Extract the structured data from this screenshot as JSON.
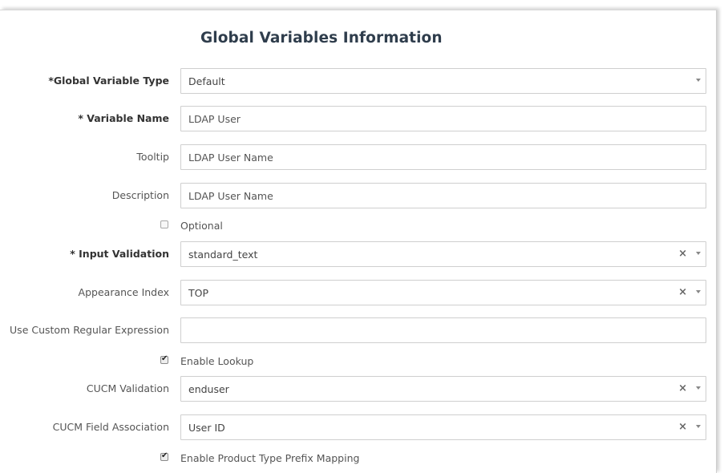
{
  "form": {
    "title": "Global Variables Information",
    "global_variable_type": {
      "label": "*Global Variable Type",
      "value": "Default"
    },
    "variable_name": {
      "label": "* Variable Name",
      "value": "LDAP User"
    },
    "tooltip": {
      "label": "Tooltip",
      "value": "LDAP User Name"
    },
    "description": {
      "label": "Description",
      "value": "LDAP User Name"
    },
    "optional": {
      "label": "Optional",
      "checked": false
    },
    "input_validation": {
      "label": "* Input Validation",
      "value": "standard_text"
    },
    "appearance_index": {
      "label": "Appearance Index",
      "value": "TOP"
    },
    "custom_regex": {
      "label": "Use Custom Regular Expression",
      "value": ""
    },
    "enable_lookup": {
      "label": "Enable Lookup",
      "checked": true
    },
    "cucm_validation": {
      "label": "CUCM Validation",
      "value": "enduser"
    },
    "cucm_field_association": {
      "label": "CUCM Field Association",
      "value": "User ID"
    },
    "enable_prefix_mapping": {
      "label": "Enable Product Type Prefix Mapping",
      "checked": true
    }
  },
  "icons": {
    "clear": "×",
    "caret": "chevron-down-icon",
    "check": "✔"
  }
}
